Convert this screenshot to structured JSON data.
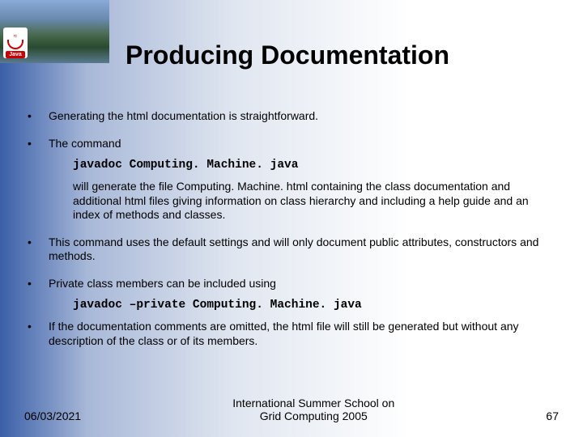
{
  "title": "Producing Documentation",
  "bullets": {
    "b1": "Generating the html documentation is straightforward.",
    "b2": "The command",
    "code1": "javadoc Computing. Machine. java",
    "follow1": "will generate the file Computing. Machine. html containing the class documentation and additional html files giving information on class hierarchy and including a help guide and an index of methods and classes.",
    "b3": "This command uses the default settings and will only document public attributes, constructors and methods.",
    "b4": "Private class members can be included using",
    "code2": "javadoc –private Computing. Machine. java",
    "b5": "If the documentation comments are omitted, the html file will still be generated but without any description of the class or  of  its members."
  },
  "footer": {
    "date": "06/03/2021",
    "center": "International Summer School on\nGrid Computing 2005",
    "page": "67"
  },
  "logo": {
    "text": "Java"
  }
}
